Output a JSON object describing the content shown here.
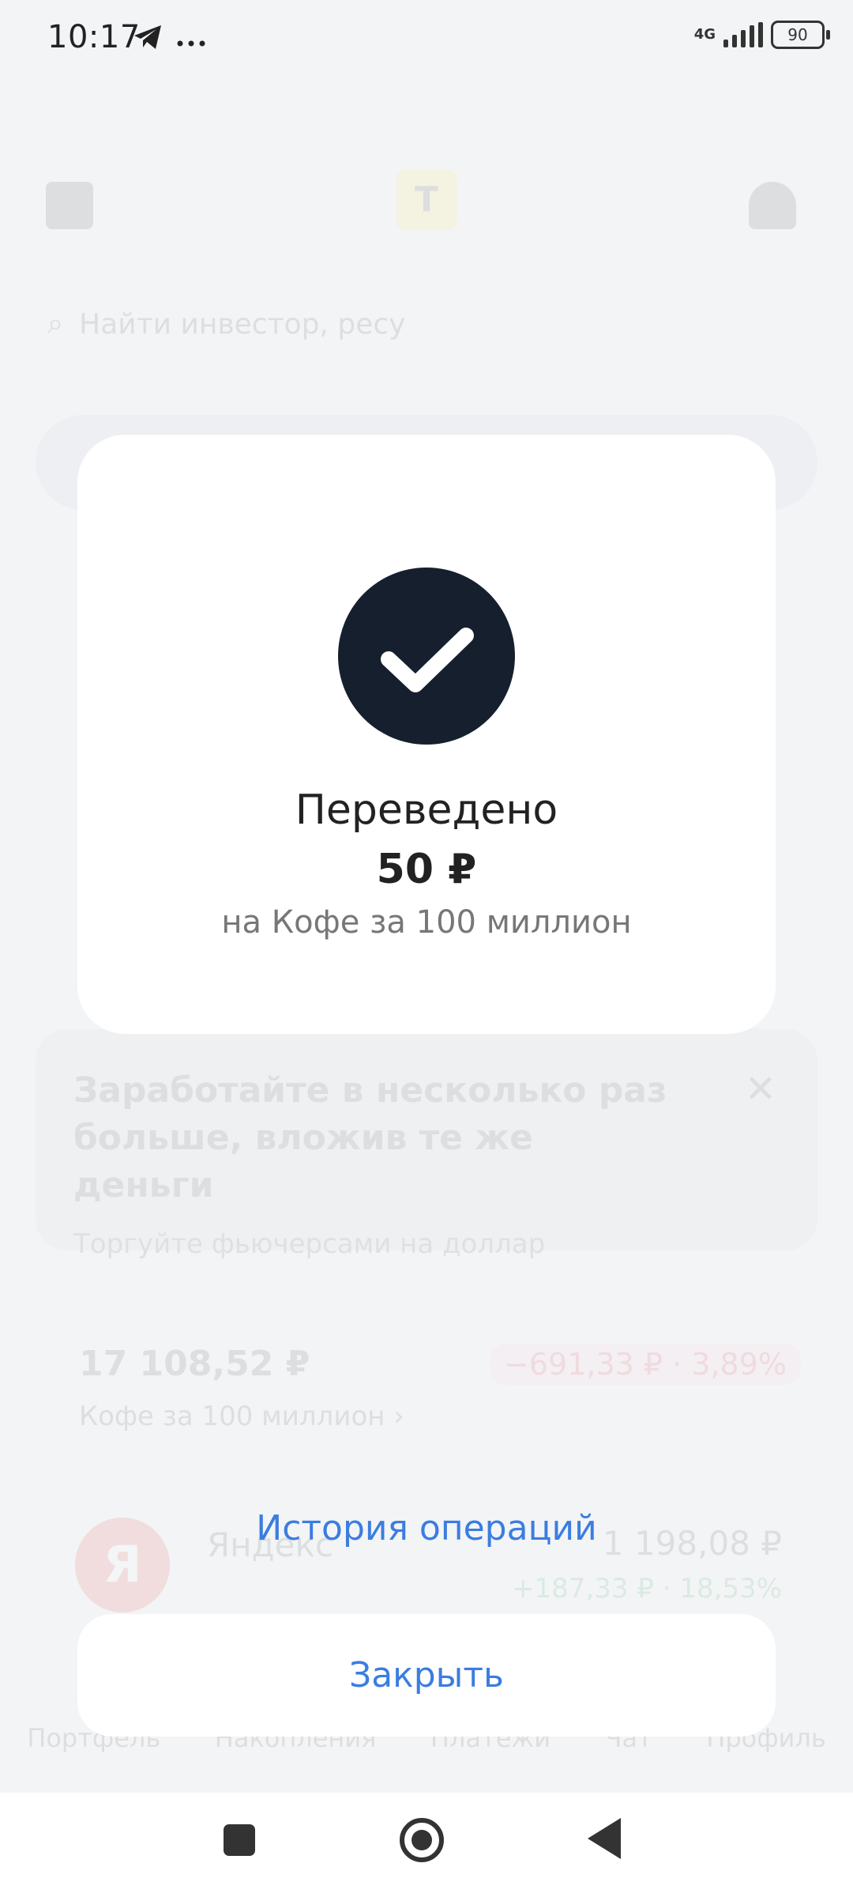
{
  "status_bar": {
    "time": "10:17",
    "network": "4G",
    "battery": "90",
    "icons": [
      "telegram-icon",
      "more-dots-icon",
      "signal-icon",
      "battery-icon"
    ]
  },
  "background": {
    "search_placeholder": "Найти инвестор, ресу",
    "promo": {
      "title": "Заработайте в несколько раз больше, вложив те же деньги",
      "subtitle": "Торгуйте фьючерсами на доллар",
      "close": "✕"
    },
    "account": {
      "balance": "17 108,52 ₽",
      "change": "−691,33 ₽ · 3,89%",
      "name": "Кофе за 100 миллион ›"
    },
    "position": {
      "logo": "Я",
      "name": "Яндекс",
      "price": "1 198,08 ₽",
      "change": "+187,33 ₽ · 18,53%"
    },
    "tabs": [
      "Портфель",
      "Накопления",
      "Платежи",
      "Чат",
      "Профиль"
    ]
  },
  "dialog": {
    "title": "Переведено",
    "amount": "50 ₽",
    "description": "на Кофе за 100 миллион",
    "history_link": "История операций",
    "close_button": "Закрыть"
  },
  "colors": {
    "accent_link": "#3b7de0",
    "check_circle": "#161f2d",
    "brand_yellow": "#ffdd2d"
  }
}
